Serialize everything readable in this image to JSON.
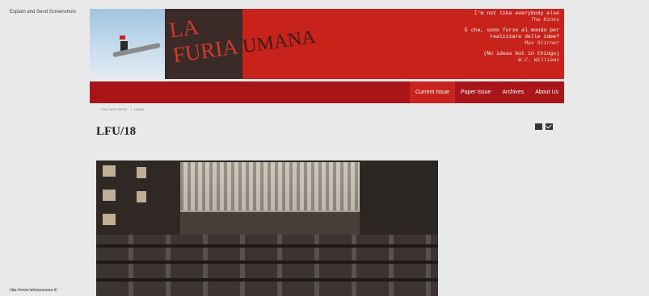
{
  "toolbar": {
    "explain_label": "Explain and Send Screenshots"
  },
  "status": {
    "url": "http://www.lafuriaumana.it/"
  },
  "header": {
    "logo_line1": "LA",
    "logo_line2_a": "FURIA",
    "logo_line2_b": "UMANA",
    "quotes": [
      {
        "lines": [
          "I'm not like everybody else"
        ],
        "author": "The Kinks"
      },
      {
        "lines": [
          "E che, sono forse al mondo per",
          "realizzare delle idee?"
        ],
        "author": "Max Stirner"
      },
      {
        "lines": [
          "(No ideas but in things)"
        ],
        "author": "W.C. Williams"
      }
    ]
  },
  "nav": {
    "items": [
      "Current Issue",
      "Paper Issue",
      "Archives",
      "About Us"
    ],
    "active": "Current Issue"
  },
  "breadcrumb": {
    "you_are_here": "YOU ARE HERE:",
    "home": "HOME"
  },
  "page": {
    "title": "LFU/18"
  },
  "colors": {
    "header_red": "#c8231b",
    "nav_red": "#a8161a",
    "page_bg": "#e9e9e9"
  },
  "icons": [
    "print-icon",
    "email-icon"
  ]
}
